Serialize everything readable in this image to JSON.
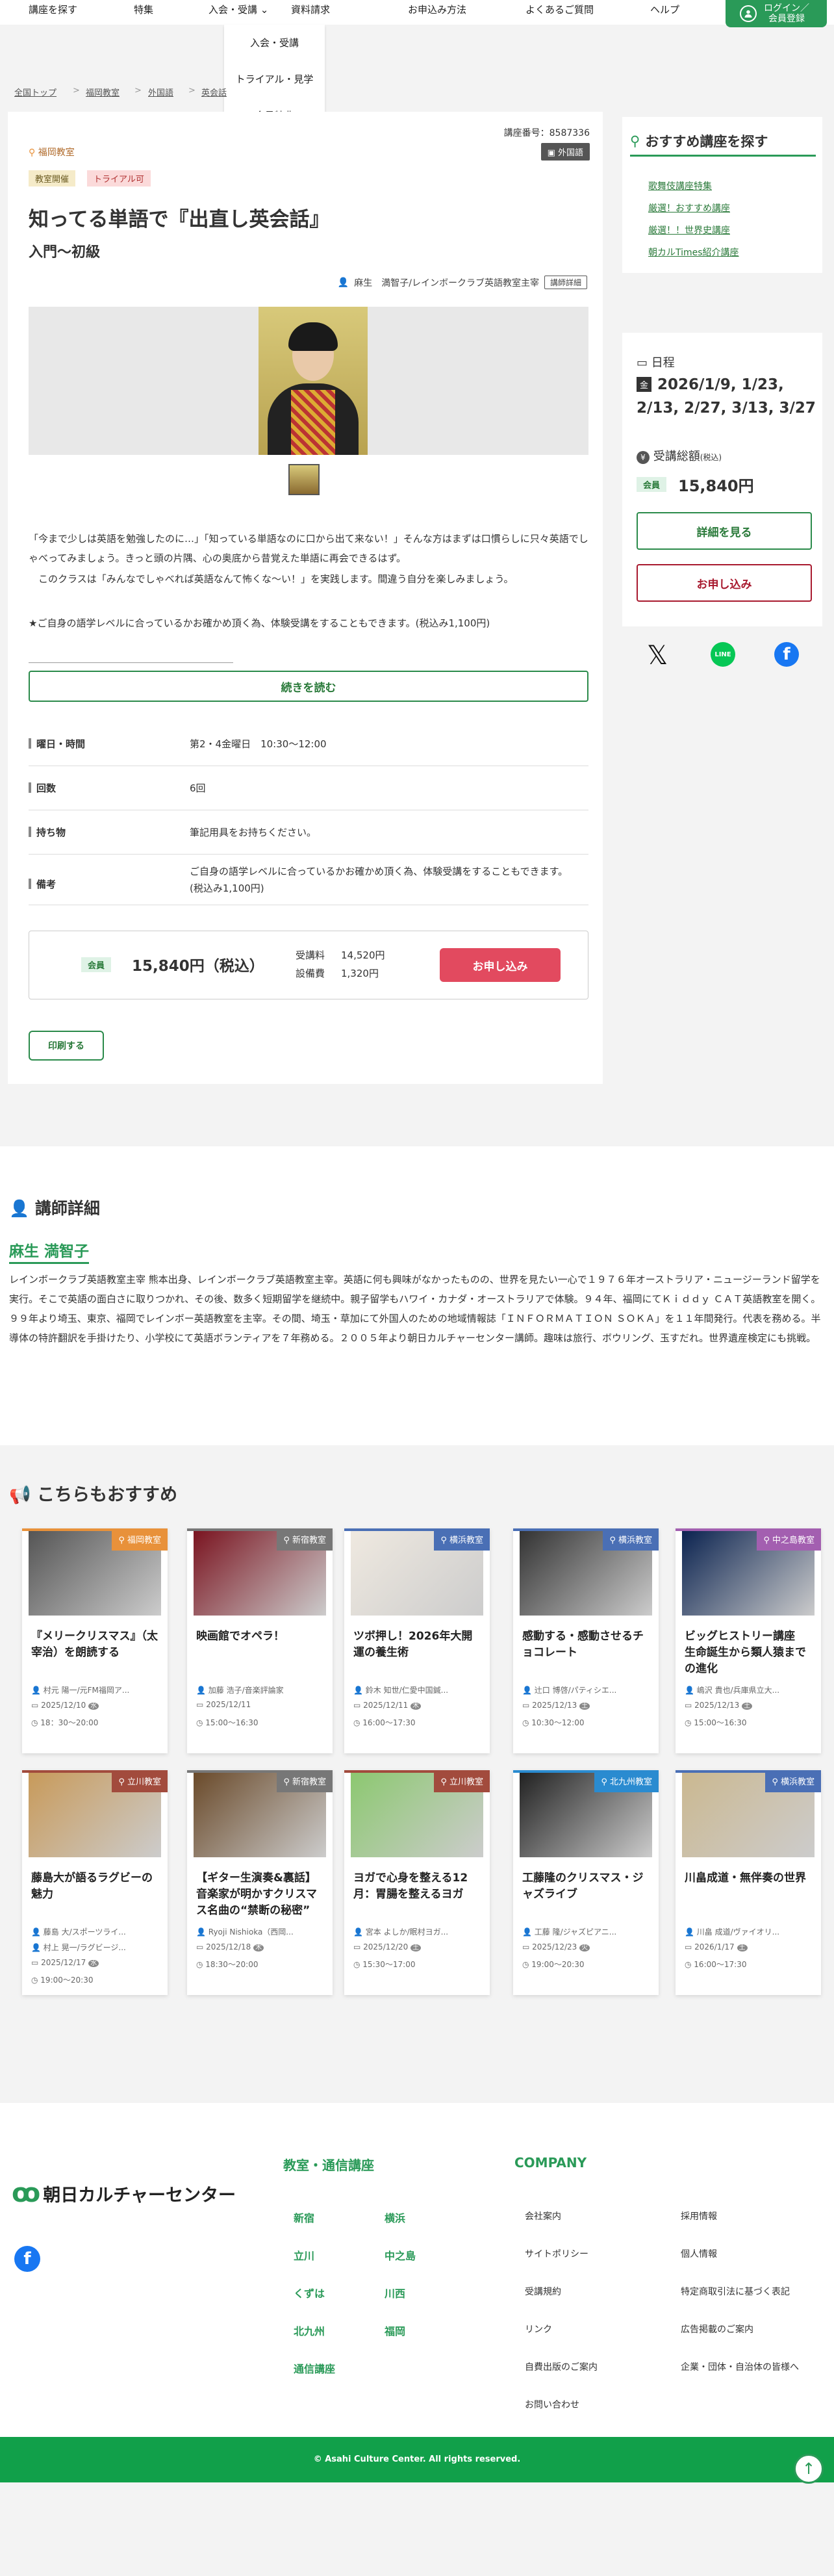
{
  "nav": {
    "items": [
      "講座を探す",
      "特集",
      "入会・受講",
      "資料請求",
      "お申込み方法",
      "よくあるご質問",
      "ヘルプ"
    ],
    "dropdown": [
      "入会・受講",
      "トライアル・見学",
      "会員特典"
    ],
    "login": "ログイン／会員登録"
  },
  "breadcrumb": [
    "全国トップ",
    "福岡教室",
    "外国語",
    "英会話"
  ],
  "course": {
    "number": "講座番号：8587336",
    "location": "福岡教室",
    "category": "外国語",
    "tags": [
      "教室開催",
      "トライアル可"
    ],
    "title": "知ってる単語で『出直し英会話』",
    "subtitle": "入門〜初級",
    "teacher_line": "麻生　満智子/レインボークラブ英語教室主宰",
    "teacher_btn": "講師詳細",
    "desc1": "「今まで少しは英語を勉強したのに…」「知っている単語なのに口から出て来ない！」そんな方はまずは口慣らしに只々英語でしゃべってみましょう。きっと頭の片隅、心の奥底から昔覚えた単語に再会できるはず。",
    "desc2": "　このクラスは「みんなでしゃべれば英語なんて怖くな〜い！」を実践します。間違う自分を楽しみましょう。",
    "desc3": "★ご自身の語学レベルに合っているかお確かめ頂く為、体験受講をすることもできます。(税込み1,100円)",
    "divider": "＿＿＿＿＿＿＿＿＿＿＿＿＿＿＿＿＿＿＿＿＿",
    "read_more": "続きを読む",
    "details": [
      {
        "label": "曜日・時間",
        "value": "第2・4金曜日　10:30〜12:00"
      },
      {
        "label": "回数",
        "value": "6回"
      },
      {
        "label": "持ち物",
        "value": "筆記用具をお持ちください。"
      },
      {
        "label": "備考",
        "value": "ご自身の語学レベルに合っているかお確かめ頂く為、体験受講をすることもできます。(税込み1,100円)"
      }
    ],
    "price_badge": "会員",
    "price": "15,840円（税込）",
    "fee_label": "受講料",
    "fee": "14,520円",
    "facility_label": "設備費",
    "facility": "1,320円",
    "apply": "お申し込み",
    "print": "印刷する"
  },
  "side": {
    "search_title": "おすすめ講座を探す",
    "links": [
      "歌舞伎講座特集",
      "厳選！おすすめ講座",
      "厳選！！世界史講座",
      "朝カルTimes紹介講座"
    ],
    "schedule_label": "日程",
    "schedule_badge": "金",
    "schedule": "2026/1/9, 1/23, 2/13, 2/27, 3/13, 3/27",
    "fee_label": "受講総額",
    "fee_note": "(税込)",
    "fee_badge": "会員",
    "fee": "15,840円",
    "detail_btn": "詳細を見る",
    "apply_btn": "お申し込み"
  },
  "instructor": {
    "section": "講師詳細",
    "name": "麻生 満智子",
    "bio": "レインボークラブ英語教室主宰 熊本出身、レインボークラブ英語教室主宰。英語に何も興味がなかったものの、世界を見たい一心で１９７６年オーストラリア・ニュージーランド留学を実行。そこで英語の面白さに取りつかれ、その後、数多く短期留学を継続中。親子留学もハワイ・カナダ・オーストラリアで体験。９４年、福岡にてＫｉｄｄｙ ＣＡＴ英語教室を開く。９９年より埼玉、東京、福岡でレインボー英語教室を主宰。その間、埼玉・草加にて外国人のための地域情報誌「ＩＮＦＯＲＭＡＴＩＯＮ ＳＯＫＡ」を１１年間発行。代表を務める。半導体の特許翻訳を手掛けたり、小学校にて英語ボランティアを７年務める。２００５年より朝日カルチャーセンター講師。趣味は旅行、ボウリング、玉すだれ。世界遺産検定にも挑戦。"
  },
  "recommend": {
    "section": "こちらもおすすめ",
    "cards": [
      {
        "loc": "福岡教室",
        "color": "#e8913a",
        "title": "『メリークリスマス』（太宰治）を朗読する",
        "teacher": "村元 陽一/元FM福岡ア...",
        "date": "2025/12/10",
        "day": "水",
        "time": "18：30〜20:00"
      },
      {
        "loc": "新宿教室",
        "color": "#777777",
        "title": "映画館でオペラ！",
        "teacher": "加藤 浩子/音楽評論家",
        "date": "2025/12/11",
        "day": "",
        "time": "15:00〜16:30"
      },
      {
        "loc": "横浜教室",
        "color": "#4a6fb5",
        "title": "ツボ押し！2026年大開運の養生術",
        "teacher": "鈴木 知世/仁愛中国鍼...",
        "date": "2025/12/11",
        "day": "木",
        "time": "16:00〜17:30"
      },
      {
        "loc": "横浜教室",
        "color": "#4a6fb5",
        "title": "感動する・感動させるチョコレート",
        "teacher": "辻口 博啓/パティシエ...",
        "date": "2025/12/13",
        "day": "土",
        "time": "10:30〜12:00"
      },
      {
        "loc": "中之島教室",
        "color": "#a35fb0",
        "title": "ビッグヒストリー講座　生命誕生から類人猿までの進化",
        "teacher": "嶋沢 貴也/兵庫県立大...",
        "date": "2025/12/13",
        "day": "土",
        "time": "15:00〜16:30"
      },
      {
        "loc": "立川教室",
        "color": "#a24b3d",
        "title": "藤島大が語るラグビーの魅力",
        "teacher": "藤島 大/スポーツライ...",
        "teacher2": "村上 晃一/ラグビージ...",
        "date": "2025/12/17",
        "day": "水",
        "time": "19:00〜20:30"
      },
      {
        "loc": "新宿教室",
        "color": "#777777",
        "title": "【ギター生演奏&裏話】音楽家が明かすクリスマス名曲の“禁断の秘密”",
        "teacher": "Ryoji Nishioka（西岡...",
        "date": "2025/12/18",
        "day": "木",
        "time": "18:30〜20:00"
      },
      {
        "loc": "立川教室",
        "color": "#a24b3d",
        "title": "ヨガで心身を整える12月：胃腸を整えるヨガ",
        "teacher": "宮本 よしか/眠村ヨガ...",
        "date": "2025/12/20",
        "day": "土",
        "time": "15:30〜17:00"
      },
      {
        "loc": "北九州教室",
        "color": "#2a8bd0",
        "title": "工藤隆のクリスマス・ジャズライブ",
        "teacher": "工藤 隆/ジャズピアニ...",
        "date": "2025/12/23",
        "day": "火",
        "time": "19:00〜20:30"
      },
      {
        "loc": "横浜教室",
        "color": "#4a6fb5",
        "title": "川畠成道・無伴奏の世界",
        "teacher": "川畠 成道/ヴァイオリ...",
        "date": "2026/1/17",
        "day": "土",
        "time": "16:00〜17:30"
      }
    ]
  },
  "footer": {
    "logo": "朝日カルチャーセンター",
    "col1_title": "教室・通信講座",
    "classrooms": [
      "新宿",
      "横浜",
      "立川",
      "中之島",
      "くずは",
      "川西",
      "北九州",
      "福岡",
      "通信講座"
    ],
    "col2_title": "COMPANY",
    "company": [
      "会社案内",
      "採用情報",
      "サイトポリシー",
      "個人情報",
      "受講規約",
      "特定商取引法に基づく表記",
      "リンク",
      "広告掲載のご案内",
      "自費出版のご案内",
      "企業・団体・自治体の皆様へ",
      "お問い合わせ"
    ],
    "copyright": "© Asahi Culture Center. All rights reserved."
  },
  "colors": {
    "green": "#2a9a58",
    "red": "#e24a5f"
  }
}
